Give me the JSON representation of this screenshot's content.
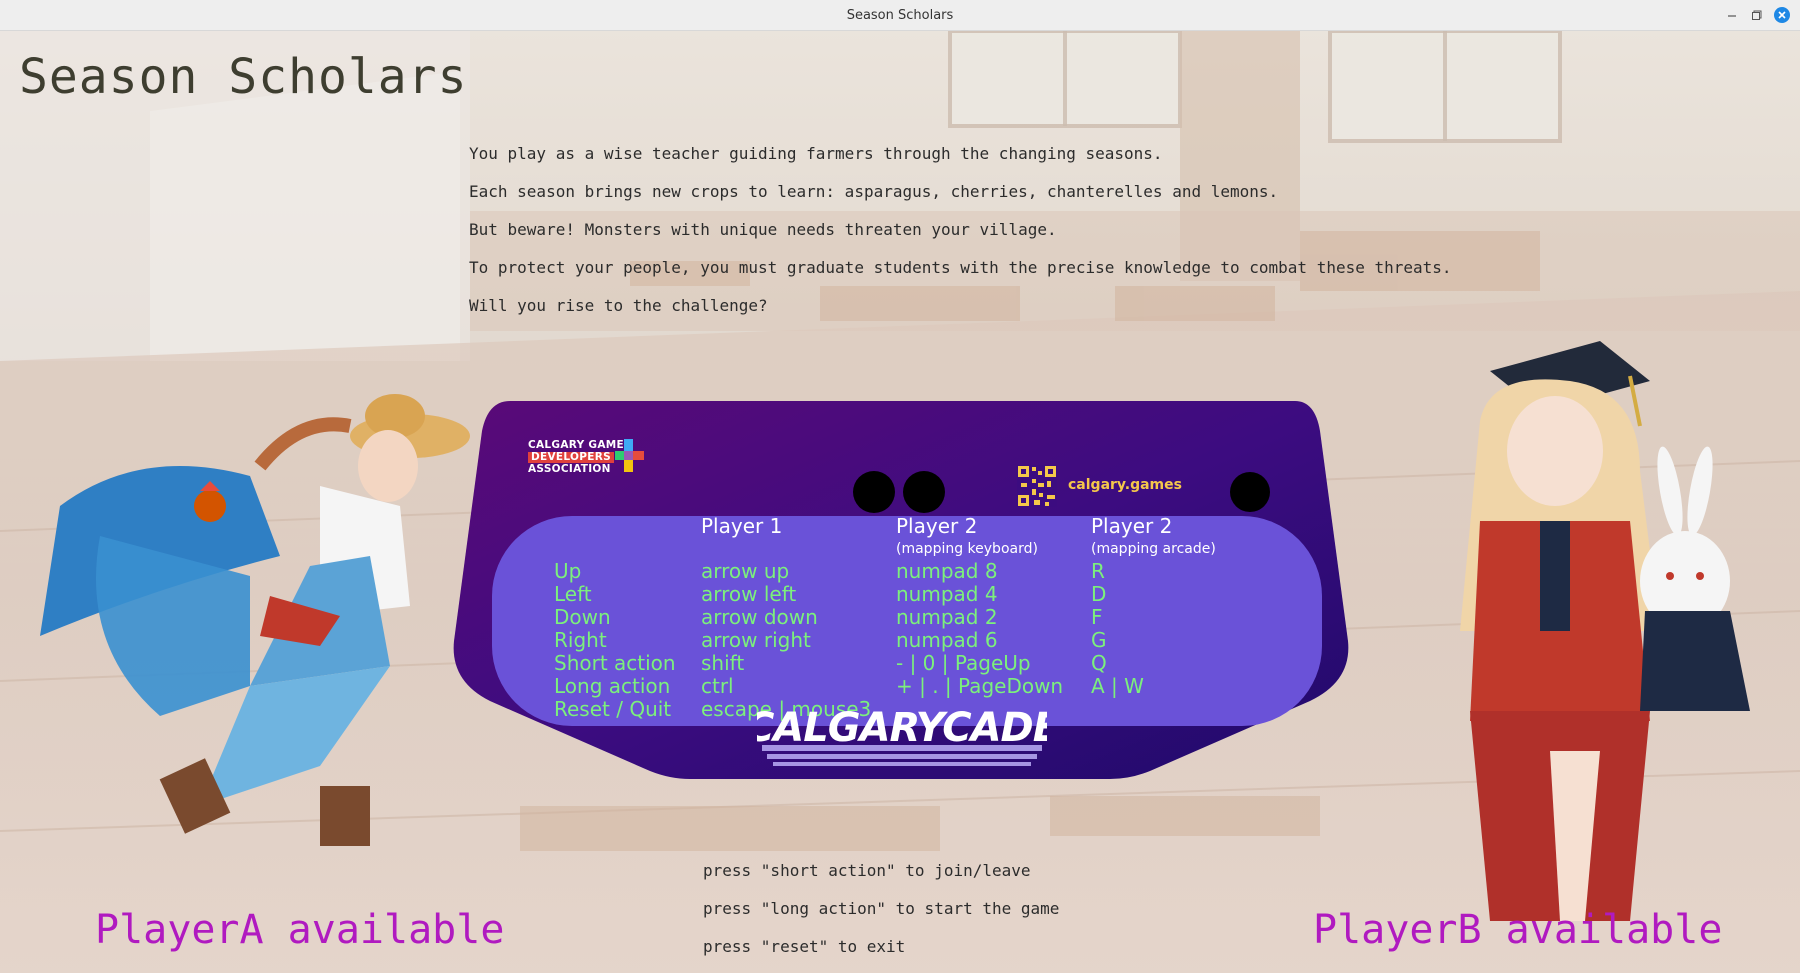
{
  "window": {
    "title": "Season Scholars"
  },
  "game": {
    "title": "Season Scholars",
    "intro": [
      "You play as a wise teacher guiding farmers through the changing seasons.",
      "Each season brings new crops to learn: asparagus, cherries, chanterelles and lemons.",
      "But beware! Monsters with unique needs threaten your village.",
      "To protect your people, you must graduate students with the precise knowledge to combat these threats.",
      "Will you rise to the challenge?"
    ]
  },
  "panel": {
    "logo_lines": [
      "CALGARY GAME",
      "DEVELOPERS",
      "ASSOCIATION"
    ],
    "site": "calgary.games",
    "brand": "CALGARYCADE",
    "headers": {
      "p1": "Player 1",
      "p2kb": "Player 2",
      "p2kb_sub": "(mapping keyboard)",
      "p2ar": "Player 2",
      "p2ar_sub": "(mapping arcade)"
    },
    "controls": [
      {
        "action": "Up",
        "p1": "arrow up",
        "p2kb": "numpad 8",
        "p2ar": "R"
      },
      {
        "action": "Left",
        "p1": "arrow left",
        "p2kb": "numpad 4",
        "p2ar": "D"
      },
      {
        "action": "Down",
        "p1": "arrow down",
        "p2kb": "numpad 2",
        "p2ar": "F"
      },
      {
        "action": "Right",
        "p1": "arrow right",
        "p2kb": "numpad 6",
        "p2ar": "G"
      },
      {
        "action": "Short action",
        "p1": "shift",
        "p2kb": "- | 0 | PageUp",
        "p2ar": "Q"
      },
      {
        "action": "Long action",
        "p1": "ctrl",
        "p2kb": "+ | . | PageDown",
        "p2ar": "A | W"
      },
      {
        "action": "Reset / Quit",
        "p1": "escape | mouse3",
        "p2kb": "",
        "p2ar": ""
      }
    ]
  },
  "hints": [
    "press \"short action\" to join/leave",
    "press \"long action\" to start the game",
    "press \"reset\" to exit"
  ],
  "players": {
    "a": "PlayerA available",
    "b": "PlayerB available"
  },
  "colors": {
    "panel": "#3b0a78",
    "panel_inner": "#6a52d8",
    "control_text": "#7cf07c",
    "available_text": "#b01ac0",
    "site_text": "#f5c84a"
  }
}
